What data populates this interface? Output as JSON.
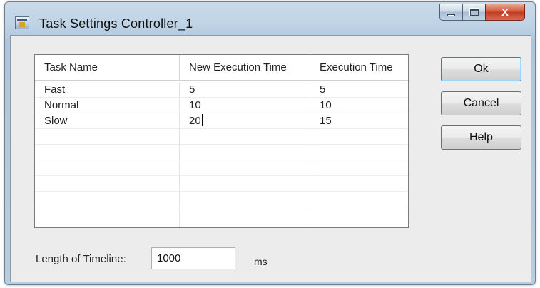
{
  "window": {
    "title": "Task Settings Controller_1",
    "buttons": {
      "minimize": "minimize",
      "maximize": "maximize",
      "close": "X"
    }
  },
  "grid": {
    "columns": [
      "Task Name",
      "New Execution Time",
      "Execution Time"
    ],
    "rows": [
      {
        "name": "Fast",
        "new_time": "5",
        "time": "5"
      },
      {
        "name": "Normal",
        "new_time": "10",
        "time": "10"
      },
      {
        "name": "Slow",
        "new_time": "20",
        "time": "15"
      }
    ]
  },
  "actions": {
    "ok": "Ok",
    "cancel": "Cancel",
    "help": "Help"
  },
  "timeline": {
    "label": "Length of Timeline:",
    "value": "1000",
    "unit": "ms"
  },
  "colors": {
    "titlebar": "#bfd3e6",
    "close": "#c03c22",
    "client": "#ececec",
    "accent": "#3c7fb1"
  },
  "icons": {
    "app": "app-window-icon"
  }
}
